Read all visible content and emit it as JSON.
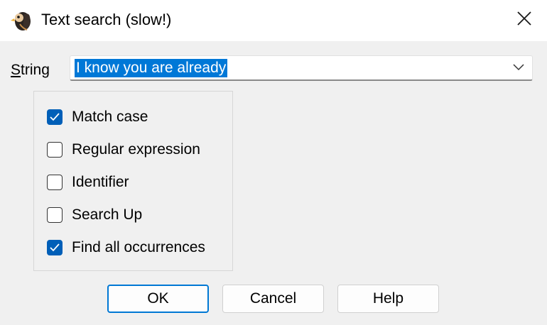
{
  "window": {
    "title": "Text search (slow!)",
    "app_icon": "parrot-app-icon",
    "close_icon": "close-icon"
  },
  "search": {
    "label": "String",
    "value": "I know you are already",
    "dropdown_icon": "chevron-down-icon"
  },
  "options": [
    {
      "label": "Match case",
      "checked": true
    },
    {
      "label": "Regular expression",
      "checked": false
    },
    {
      "label": "Identifier",
      "checked": false
    },
    {
      "label": "Search Up",
      "checked": false
    },
    {
      "label": "Find all occurrences",
      "checked": true
    }
  ],
  "buttons": {
    "ok": "OK",
    "cancel": "Cancel",
    "help": "Help"
  },
  "colors": {
    "accent": "#005fb8",
    "selection": "#0078d7",
    "default_button_border": "#0078d4"
  }
}
